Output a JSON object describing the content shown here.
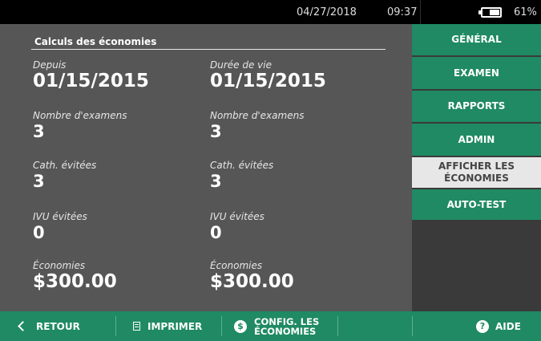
{
  "status": {
    "date": "04/27/2018",
    "time": "09:37",
    "battery_percent": "61%",
    "battery_level": 0.61
  },
  "main": {
    "title": "Calculs des économies",
    "columns": [
      {
        "stats": [
          {
            "label": "Depuis",
            "value": "01/15/2015"
          },
          {
            "label": "Nombre d'examens",
            "value": "3"
          },
          {
            "label": "Cath. évitées",
            "value": "3"
          },
          {
            "label": "IVU évitées",
            "value": "0"
          },
          {
            "label": "Économies",
            "value": "$300.00"
          }
        ]
      },
      {
        "stats": [
          {
            "label": "Durée de vie",
            "value": "01/15/2015"
          },
          {
            "label": "Nombre d'examens",
            "value": "3"
          },
          {
            "label": "Cath. évitées",
            "value": "3"
          },
          {
            "label": "IVU évitées",
            "value": "0"
          },
          {
            "label": "Économies",
            "value": "$300.00"
          }
        ]
      }
    ]
  },
  "menu": {
    "items": [
      {
        "label": "GÉNÉRAL",
        "selected": false
      },
      {
        "label": "EXAMEN",
        "selected": false
      },
      {
        "label": "RAPPORTS",
        "selected": false
      },
      {
        "label": "ADMIN",
        "selected": false
      },
      {
        "label": "AFFICHER LES ÉCONOMIES",
        "selected": true
      },
      {
        "label": "AUTO-TEST",
        "selected": false
      }
    ]
  },
  "bottom": {
    "back_label": "RETOUR",
    "print_label": "IMPRIMER",
    "config_label": "CONFIG. LES ÉCONOMIES",
    "dollar_symbol": "$",
    "help_label": "AIDE",
    "help_symbol": "?"
  },
  "colors": {
    "accent_green": "#1f8a63",
    "panel_gray": "#565656",
    "selected_bg": "#e7e7e7"
  },
  "icons": [
    "battery-icon",
    "chevron-left-icon",
    "print-icon",
    "dollar-circle-icon",
    "help-circle-icon"
  ]
}
